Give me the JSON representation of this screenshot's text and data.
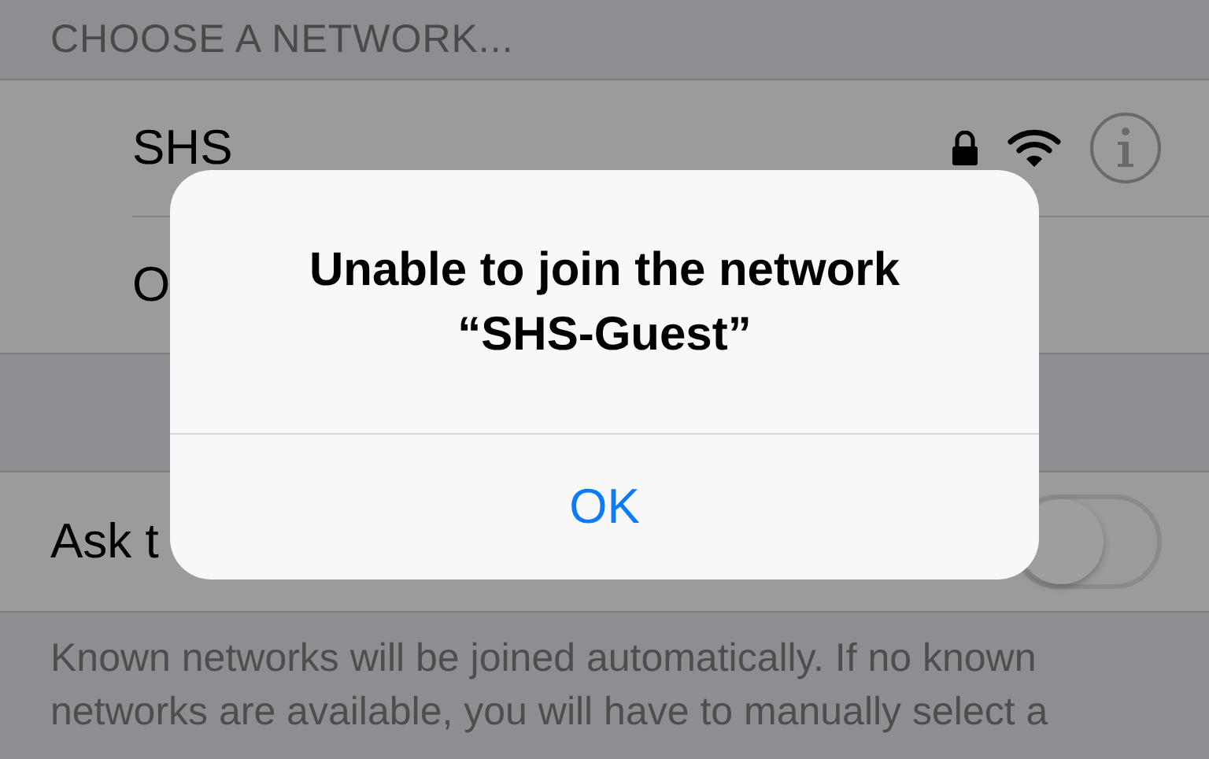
{
  "section_header": "CHOOSE A NETWORK...",
  "networks": [
    {
      "name": "SHS",
      "kind": "detailed"
    },
    {
      "name": "O",
      "kind": "plain"
    }
  ],
  "ask_to_join": {
    "label": "Ask t",
    "on": false
  },
  "footer": "Known networks will be joined automatically. If no known networks are available, you will have to manually select a",
  "alert": {
    "title": "Unable to join the network “SHS-Guest”",
    "button": "OK"
  }
}
